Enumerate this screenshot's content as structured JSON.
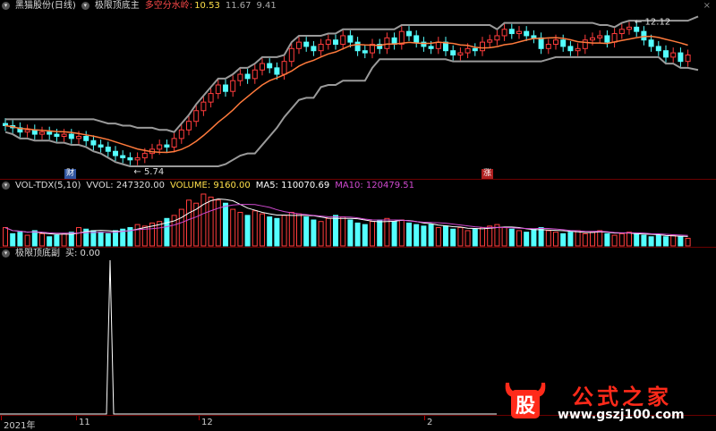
{
  "main_header": {
    "title": "黑猫股份(日线)",
    "indicator": "极限顶底主",
    "extra_label": "多空分水岭:",
    "extra_value": "10.53",
    "value2": "11.67",
    "value3": "9.41"
  },
  "main_chart": {
    "high_label": "12.12",
    "low_label": "5.74",
    "badge_cai": "财",
    "badge_zhang": "涨"
  },
  "volume_header": {
    "name": "VOL-TDX(5,10)",
    "vvol": "VVOL: 247320.00",
    "volume": "VOLUME: 9160.00",
    "ma5": "MA5: 110070.69",
    "ma10": "MA10: 120479.51"
  },
  "indicator_header": {
    "name": "极限顶底副",
    "buy": "买: 0.00"
  },
  "time_axis": {
    "ticks": [
      "2021年",
      "11",
      "12",
      "2"
    ]
  },
  "corner_button": "×",
  "colors": {
    "up": "#ff3c3c",
    "down": "#54ffff",
    "ma_line": "#ff7a3c",
    "band": "#9a9a9a",
    "grid_border": "#6b0000"
  },
  "chart_data": {
    "type": "candlestick",
    "closes": [
      7.4,
      7.3,
      7.1,
      7.2,
      7.0,
      7.1,
      7.0,
      6.9,
      7.0,
      6.8,
      6.9,
      6.7,
      6.5,
      6.4,
      6.2,
      6.0,
      5.9,
      5.8,
      5.9,
      6.1,
      6.3,
      6.5,
      6.4,
      6.8,
      7.2,
      7.6,
      8.1,
      8.5,
      8.9,
      9.3,
      9.0,
      9.5,
      9.8,
      9.6,
      10.0,
      10.3,
      10.1,
      9.8,
      10.4,
      11.0,
      11.3,
      11.1,
      10.9,
      11.2,
      11.4,
      11.2,
      11.6,
      11.3,
      10.9,
      10.8,
      11.2,
      11.0,
      11.5,
      11.2,
      11.8,
      11.6,
      11.3,
      11.1,
      11.0,
      11.3,
      10.9,
      10.7,
      10.8,
      11.0,
      10.9,
      11.3,
      11.4,
      11.6,
      11.9,
      11.7,
      11.8,
      11.6,
      11.5,
      11.0,
      11.2,
      11.4,
      11.1,
      10.9,
      11.0,
      11.4,
      11.5,
      11.6,
      11.3,
      11.7,
      11.9,
      12.0,
      11.8,
      11.4,
      11.1,
      10.9,
      10.6,
      10.8,
      10.4,
      10.7
    ],
    "volumes": [
      60,
      40,
      45,
      35,
      50,
      40,
      30,
      35,
      40,
      45,
      60,
      55,
      50,
      45,
      40,
      50,
      55,
      60,
      70,
      65,
      75,
      80,
      90,
      100,
      120,
      150,
      140,
      170,
      160,
      150,
      140,
      120,
      110,
      100,
      115,
      105,
      95,
      90,
      100,
      110,
      105,
      95,
      85,
      80,
      90,
      100,
      95,
      85,
      75,
      70,
      80,
      85,
      90,
      80,
      85,
      75,
      70,
      65,
      70,
      60,
      65,
      55,
      60,
      50,
      55,
      60,
      65,
      70,
      60,
      55,
      50,
      45,
      55,
      60,
      50,
      45,
      40,
      45,
      50,
      40,
      45,
      50,
      40,
      35,
      40,
      45,
      40,
      35,
      30,
      35,
      30,
      35,
      30,
      25
    ],
    "indicator_spike_index": 27,
    "indicator_value": 0
  }
}
